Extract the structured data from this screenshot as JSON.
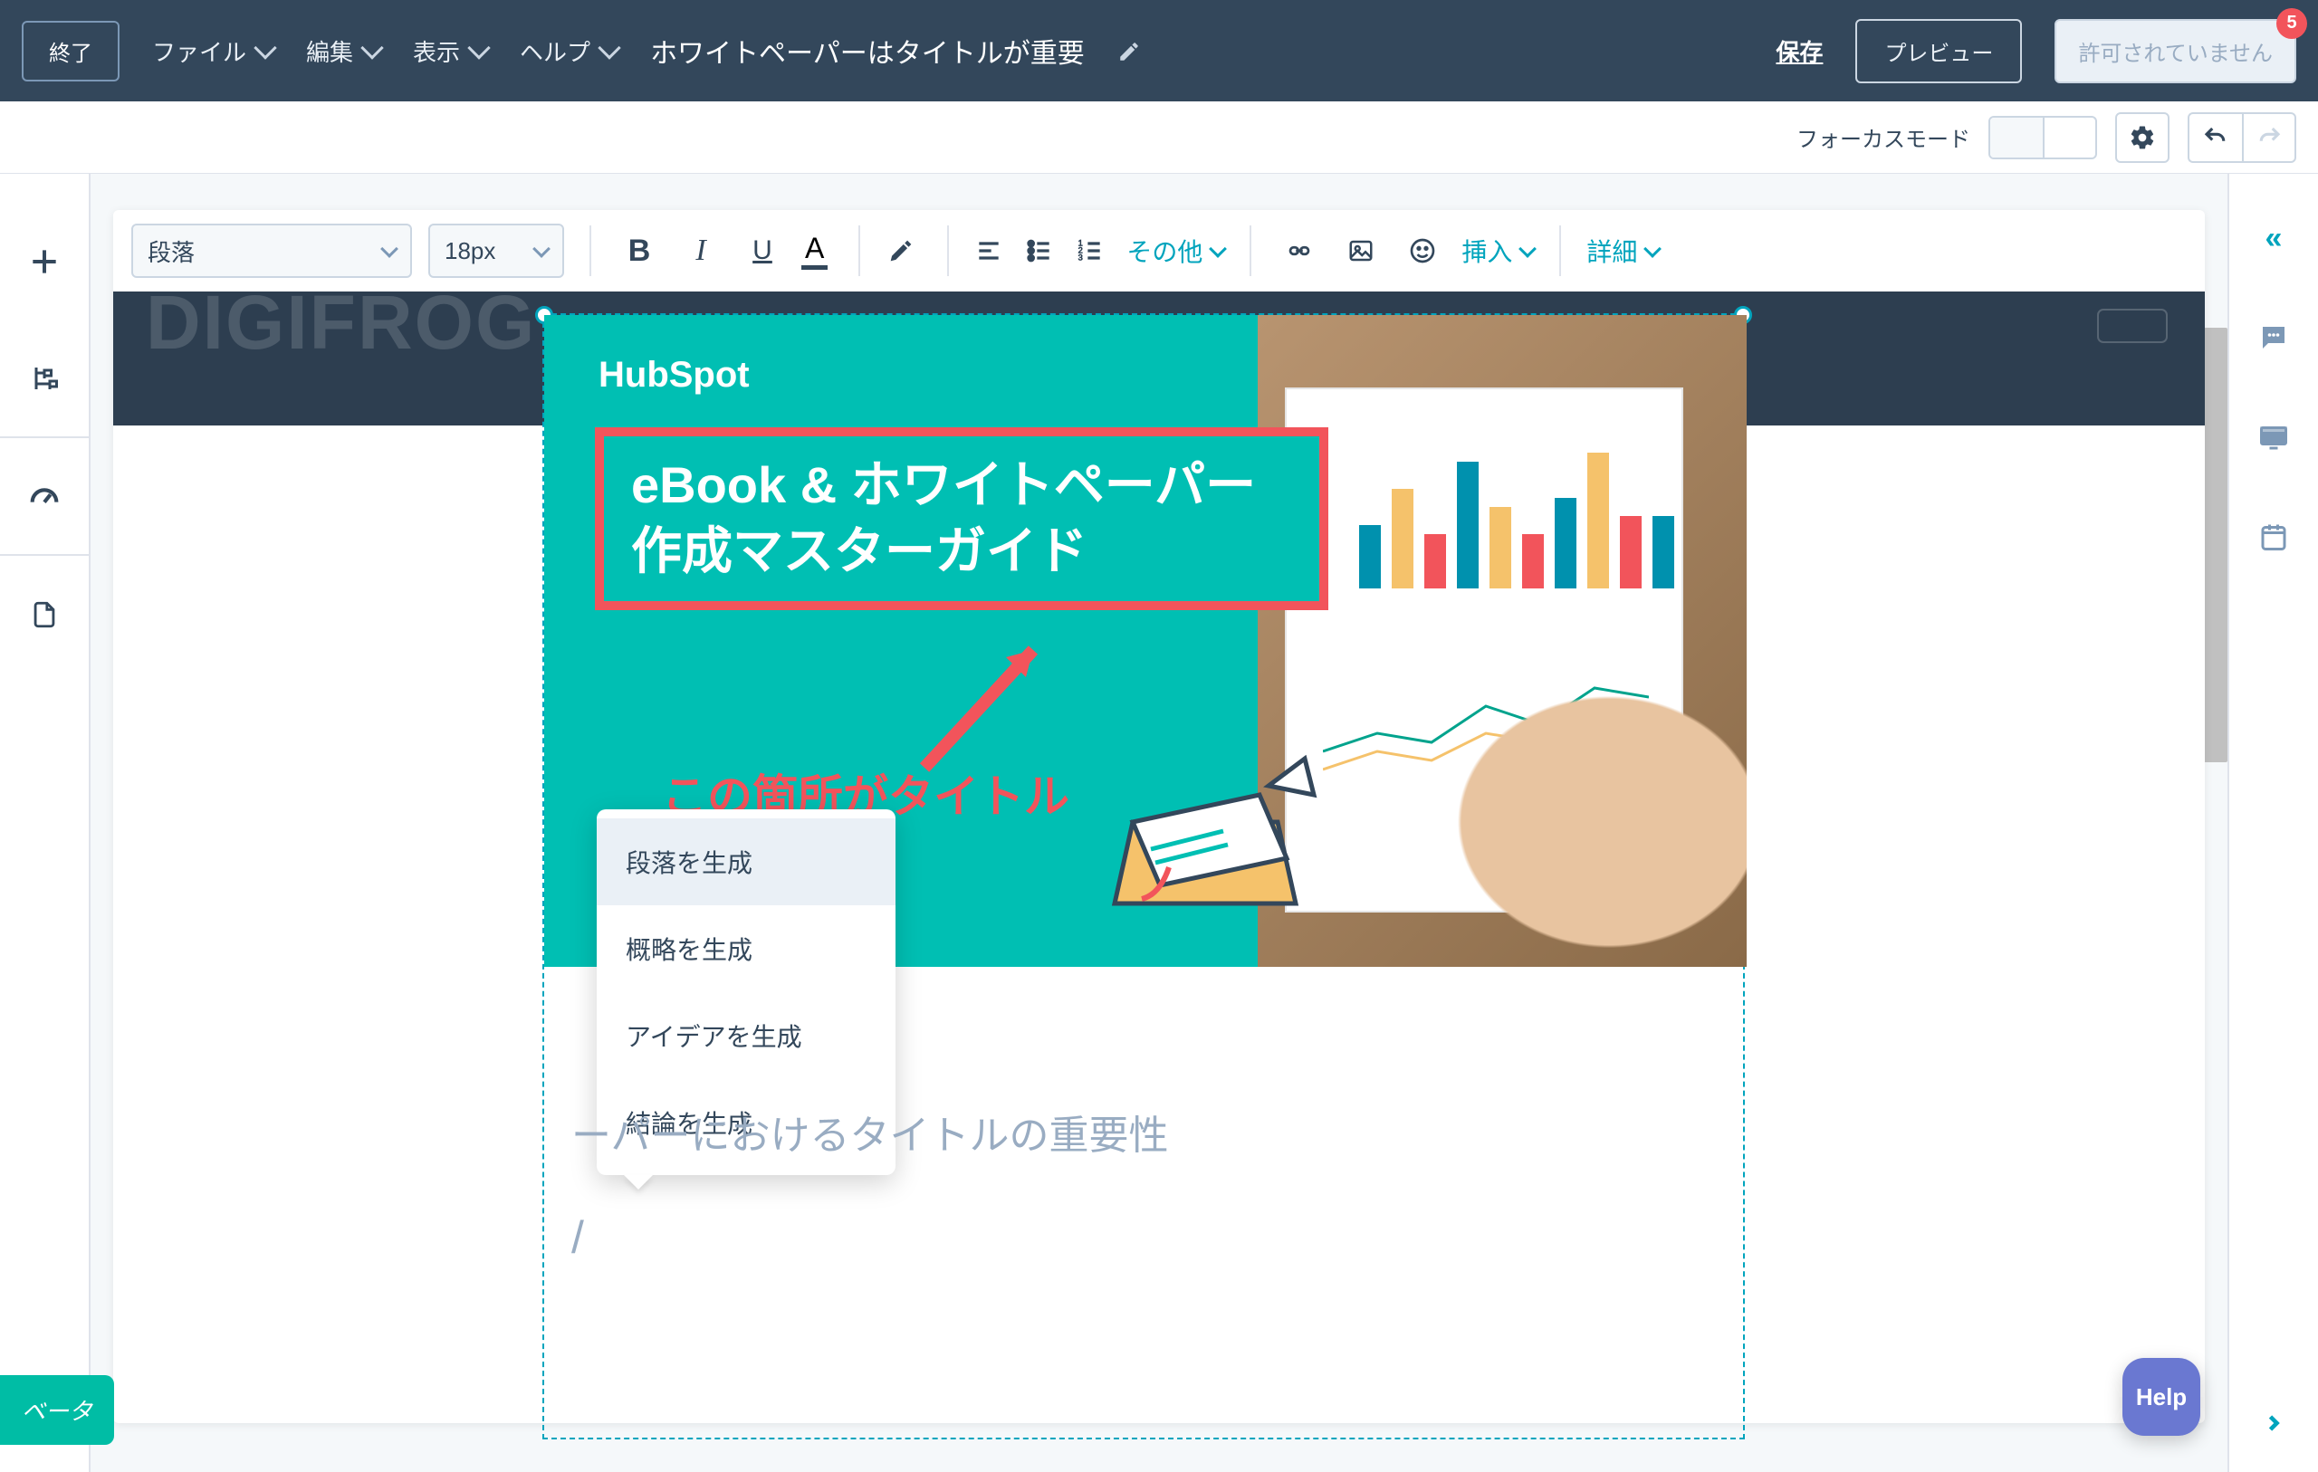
{
  "topbar": {
    "exit": "終了",
    "file": "ファイル",
    "edit": "編集",
    "view": "表示",
    "help": "ヘルプ",
    "title": "ホワイトペーパーはタイトルが重要",
    "save": "保存",
    "preview": "プレビュー",
    "not_allowed": "許可されていません",
    "badge": "5"
  },
  "subtoolbar": {
    "focus": "フォーカスモード"
  },
  "rte": {
    "style": "段落",
    "fontsize": "18px",
    "more": "その他",
    "insert": "挿入",
    "detail": "詳細"
  },
  "hero": {
    "brand": "HubSpot",
    "title_line1": "eBook & ホワイトペーパー",
    "title_line2": "作成マスターガイド",
    "pointer": "この箇所がタイトル"
  },
  "ctx": {
    "i1": "段落を生成",
    "i2": "概略を生成",
    "i3": "アイデアを生成",
    "i4": "結論を生成"
  },
  "body": {
    "heading": "ーパーにおけるタイトルの重要性",
    "slash": "/"
  },
  "beta": "ベータ",
  "help": "Help"
}
